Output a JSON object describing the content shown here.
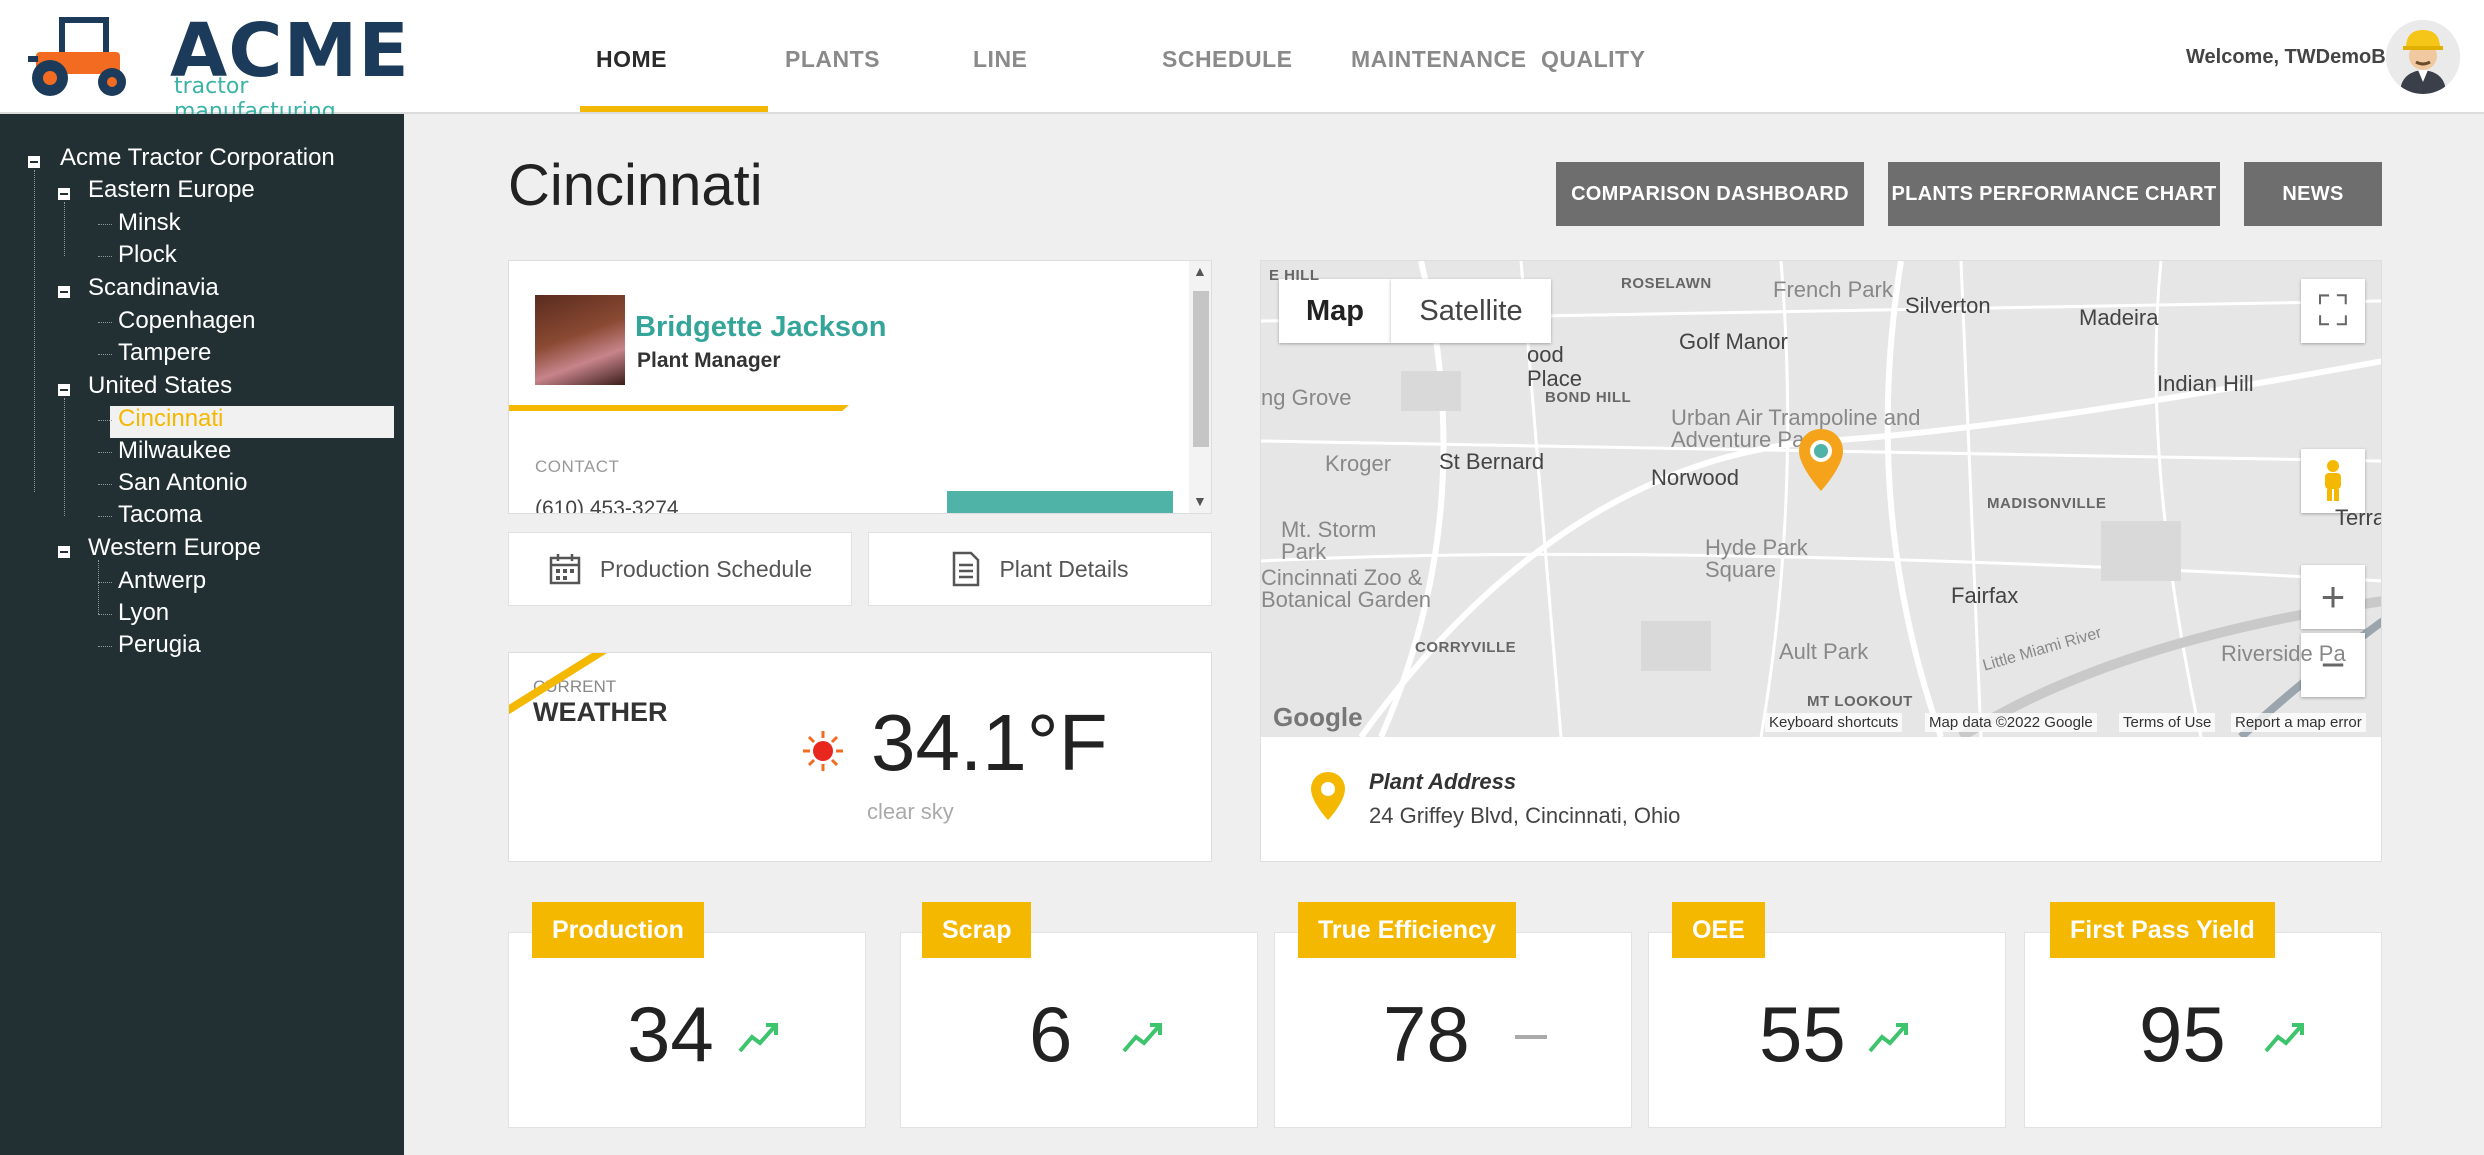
{
  "header": {
    "logo_text": "ACME",
    "logo_sub": "tractor manufacturing",
    "nav": [
      "HOME",
      "PLANTS",
      "LINE",
      "SCHEDULE",
      "MAINTENANCE",
      "QUALITY"
    ],
    "active_nav": "HOME",
    "welcome": "Welcome, TWDemoB"
  },
  "tree": {
    "root": "Acme Tractor Corporation",
    "regions": [
      {
        "name": "Eastern Europe",
        "plants": [
          "Minsk",
          "Plock"
        ]
      },
      {
        "name": "Scandinavia",
        "plants": [
          "Copenhagen",
          "Tampere"
        ]
      },
      {
        "name": "United States",
        "plants": [
          "Cincinnati",
          "Milwaukee",
          "San Antonio",
          "Tacoma"
        ]
      },
      {
        "name": "Western Europe",
        "plants": [
          "Antwerp",
          "Lyon",
          "Perugia"
        ]
      }
    ],
    "selected": "Cincinnati"
  },
  "page": {
    "title": "Cincinnati",
    "buttons": [
      "COMPARISON DASHBOARD",
      "PLANTS PERFORMANCE CHART",
      "NEWS"
    ]
  },
  "manager": {
    "name": "Bridgette Jackson",
    "role": "Plant Manager",
    "contact_label": "CONTACT",
    "phone": "(610) 453-3274"
  },
  "links": {
    "schedule": "Production Schedule",
    "details": "Plant Details"
  },
  "weather": {
    "current_label": "CURRENT",
    "title": "WEATHER",
    "temperature": "34.1°F",
    "description": "clear sky",
    "icon": "sun-icon"
  },
  "map": {
    "tab_map": "Map",
    "tab_satellite": "Satellite",
    "labels": {
      "roselawn": "ROSELAWN",
      "french_park": "French Park",
      "silverton": "Silverton",
      "madeira": "Madeira",
      "golf_manor": "Golf Manor",
      "indian_hill": "Indian Hill",
      "place": "ood Place",
      "bond_hill": "BOND HILL",
      "grove": "ng Grove",
      "urban_air": "Urban Air Trampoline and Adventure Park",
      "st_bernard": "St Bernard",
      "kroger": "Kroger",
      "norwood": "Norwood",
      "madisonville": "MADISONVILLE",
      "mt_storm": "Mt. Storm Park",
      "hyde_park": "Hyde Park Square",
      "zoo": "Cincinnati Zoo & Botanical Garden",
      "fairfax": "Fairfax",
      "corryville": "CORRYVILLE",
      "ault_park": "Ault Park",
      "little_miami": "Little Miami River",
      "riverside": "Riverside Pa",
      "mt_lookout": "MT LOOKOUT",
      "terrace": "Terra",
      "hill": "E HILL"
    },
    "footer": {
      "google": "Google",
      "shortcuts": "Keyboard shortcuts",
      "data": "Map data ©2022 Google",
      "terms": "Terms of Use",
      "report": "Report a map error"
    },
    "address_title": "Plant Address",
    "address": "24 Griffey Blvd, Cincinnati, Ohio"
  },
  "kpis": [
    {
      "label": "Production",
      "value": "34",
      "trend": "up"
    },
    {
      "label": "Scrap",
      "value": "6",
      "trend": "up"
    },
    {
      "label": "True Efficiency",
      "value": "78",
      "trend": "flat"
    },
    {
      "label": "OEE",
      "value": "55",
      "trend": "up"
    },
    {
      "label": "First Pass Yield",
      "value": "95",
      "trend": "up"
    }
  ],
  "colors": {
    "accent": "#f5b800",
    "teal": "#35a59a",
    "sidebar": "#233033",
    "trend_up": "#3ec46d",
    "button_gray": "#6e6e6e"
  }
}
